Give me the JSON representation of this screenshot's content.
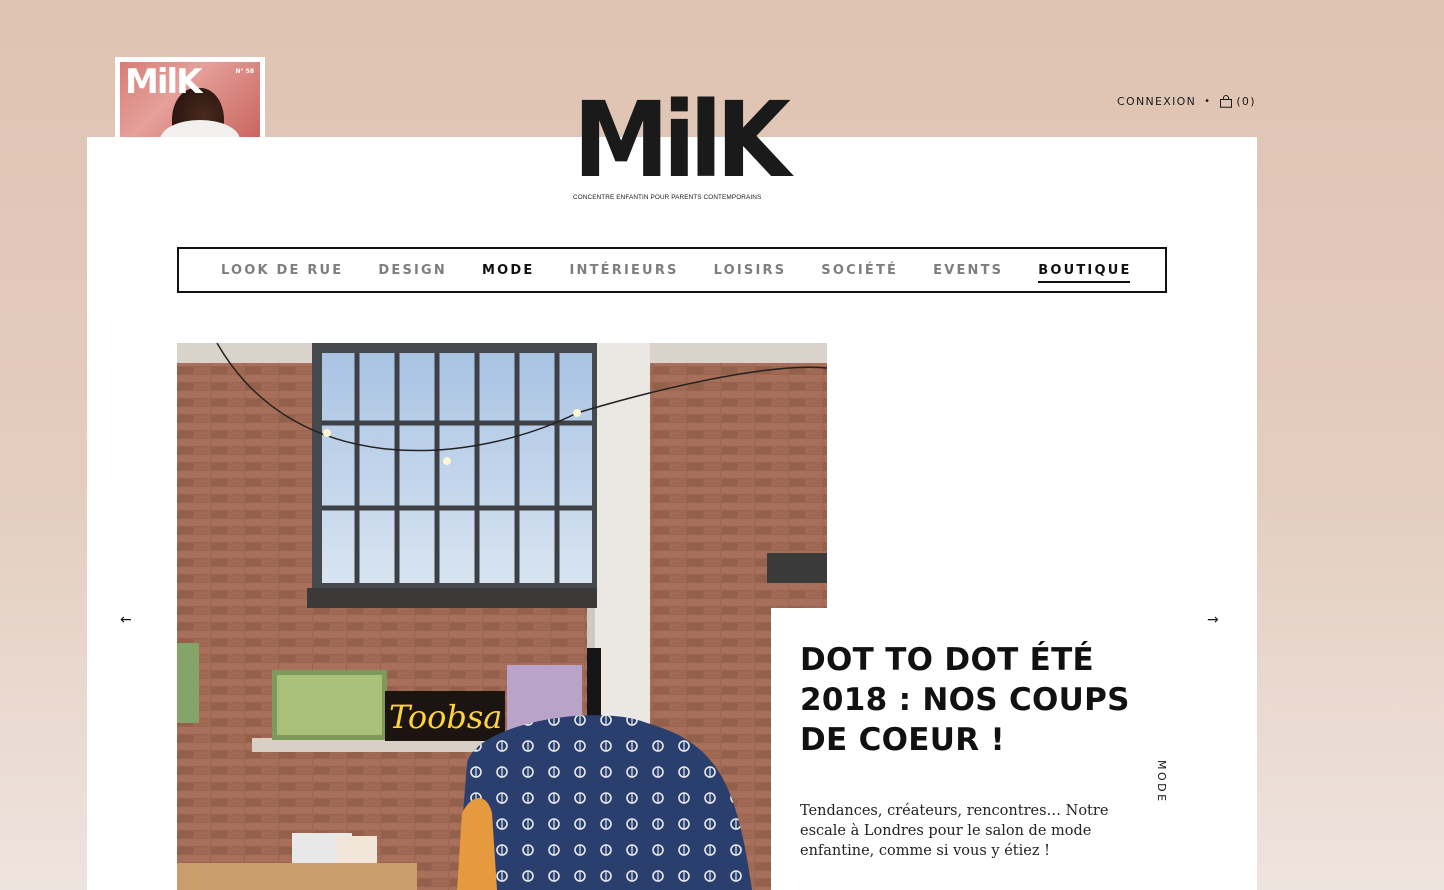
{
  "cover": {
    "logo": "MilK",
    "issue": "N° 58"
  },
  "account": {
    "login_label": "CONNEXION",
    "separator": "•",
    "cart_count": "(0)",
    "cart_icon": "shopping-bag-icon"
  },
  "logo": {
    "wordmark": "MilK",
    "tagline": "CONCENTRE ENFANTIN POUR PARENTS CONTEMPORAINS"
  },
  "nav": {
    "items": [
      {
        "label": "LOOK DE RUE"
      },
      {
        "label": "DESIGN"
      },
      {
        "label": "MODE"
      },
      {
        "label": "INTÉRIEURS"
      },
      {
        "label": "LOISIRS"
      },
      {
        "label": "SOCIÉTÉ"
      },
      {
        "label": "EVENTS"
      },
      {
        "label": "BOUTIQUE"
      }
    ],
    "search_icon": "search-icon"
  },
  "slider": {
    "prev_arrow": "←",
    "next_arrow": "→"
  },
  "article": {
    "title": "DOT TO DOT ÉTÉ 2018 : NOS COUPS DE COEUR !",
    "excerpt": "Tendances, créateurs, rencontres… Notre escale à Londres pour le salon de mode enfantine, comme si vous y étiez !",
    "category": "MODE"
  },
  "hero": {
    "neon_text": "Toobsa"
  },
  "colors": {
    "background": "#dfc3b2",
    "text": "#111111",
    "nav_inactive": "#7e7e7e"
  }
}
